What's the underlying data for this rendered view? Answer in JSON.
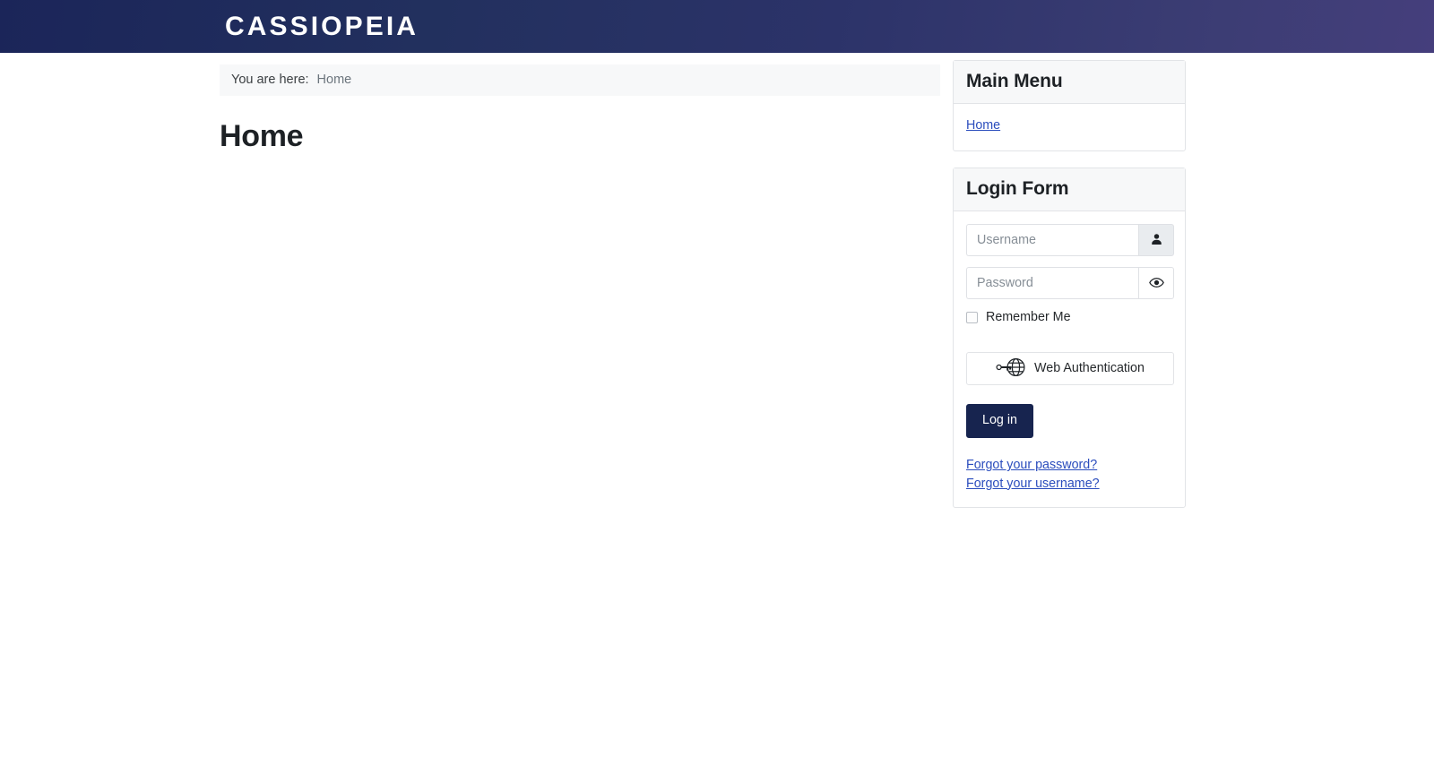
{
  "header": {
    "brand": "CASSIOPEIA",
    "gradient_from": "#1b2559",
    "gradient_to": "#453e7c"
  },
  "breadcrumb": {
    "label": "You are here:",
    "current": "Home"
  },
  "main": {
    "page_title": "Home"
  },
  "sidebar": {
    "main_menu": {
      "title": "Main Menu",
      "items": [
        {
          "label": "Home",
          "icon": "none"
        }
      ]
    },
    "login_form": {
      "title": "Login Form",
      "username": {
        "value": "",
        "placeholder": "Username",
        "button_icon": "user-icon"
      },
      "password": {
        "value": "",
        "placeholder": "Password",
        "button_icon": "eye-icon"
      },
      "remember_me": {
        "label": "Remember Me",
        "checked": false
      },
      "webauthn": {
        "label": "Web Authentication",
        "icon": "passkey-icon"
      },
      "submit": {
        "label": "Log in",
        "color": "#17244f"
      },
      "links": [
        {
          "label": "Forgot your password?"
        },
        {
          "label": "Forgot your username?"
        }
      ],
      "link_color": "#2b4dbd"
    }
  }
}
